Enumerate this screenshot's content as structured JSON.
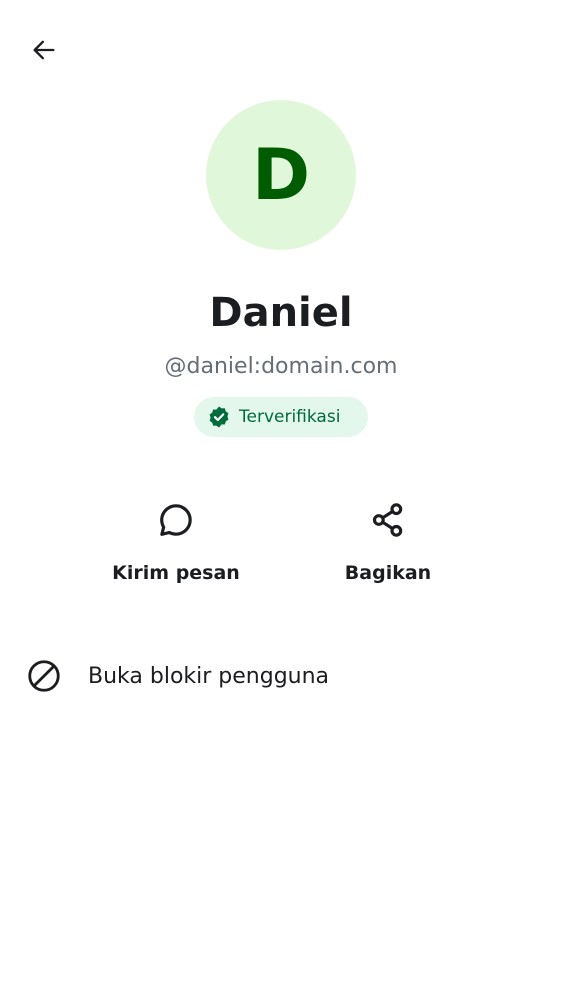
{
  "header": {
    "back_icon": "arrow-left-icon"
  },
  "profile": {
    "avatar_initial": "D",
    "avatar_bg_color": "#e0f8d9",
    "avatar_text_color": "#005c00",
    "display_name": "Daniel",
    "user_id": "@daniel:domain.com",
    "verified_label": "Terverifikasi",
    "verified_icon": "verified-shield-check-icon",
    "verified_color": "#006b3b"
  },
  "actions": [
    {
      "label": "Kirim pesan",
      "icon": "chat-bubble-icon"
    },
    {
      "label": "Bagikan",
      "icon": "share-icon"
    }
  ],
  "options": {
    "unblock_label": "Buka blokir pengguna",
    "unblock_icon": "block-icon"
  }
}
